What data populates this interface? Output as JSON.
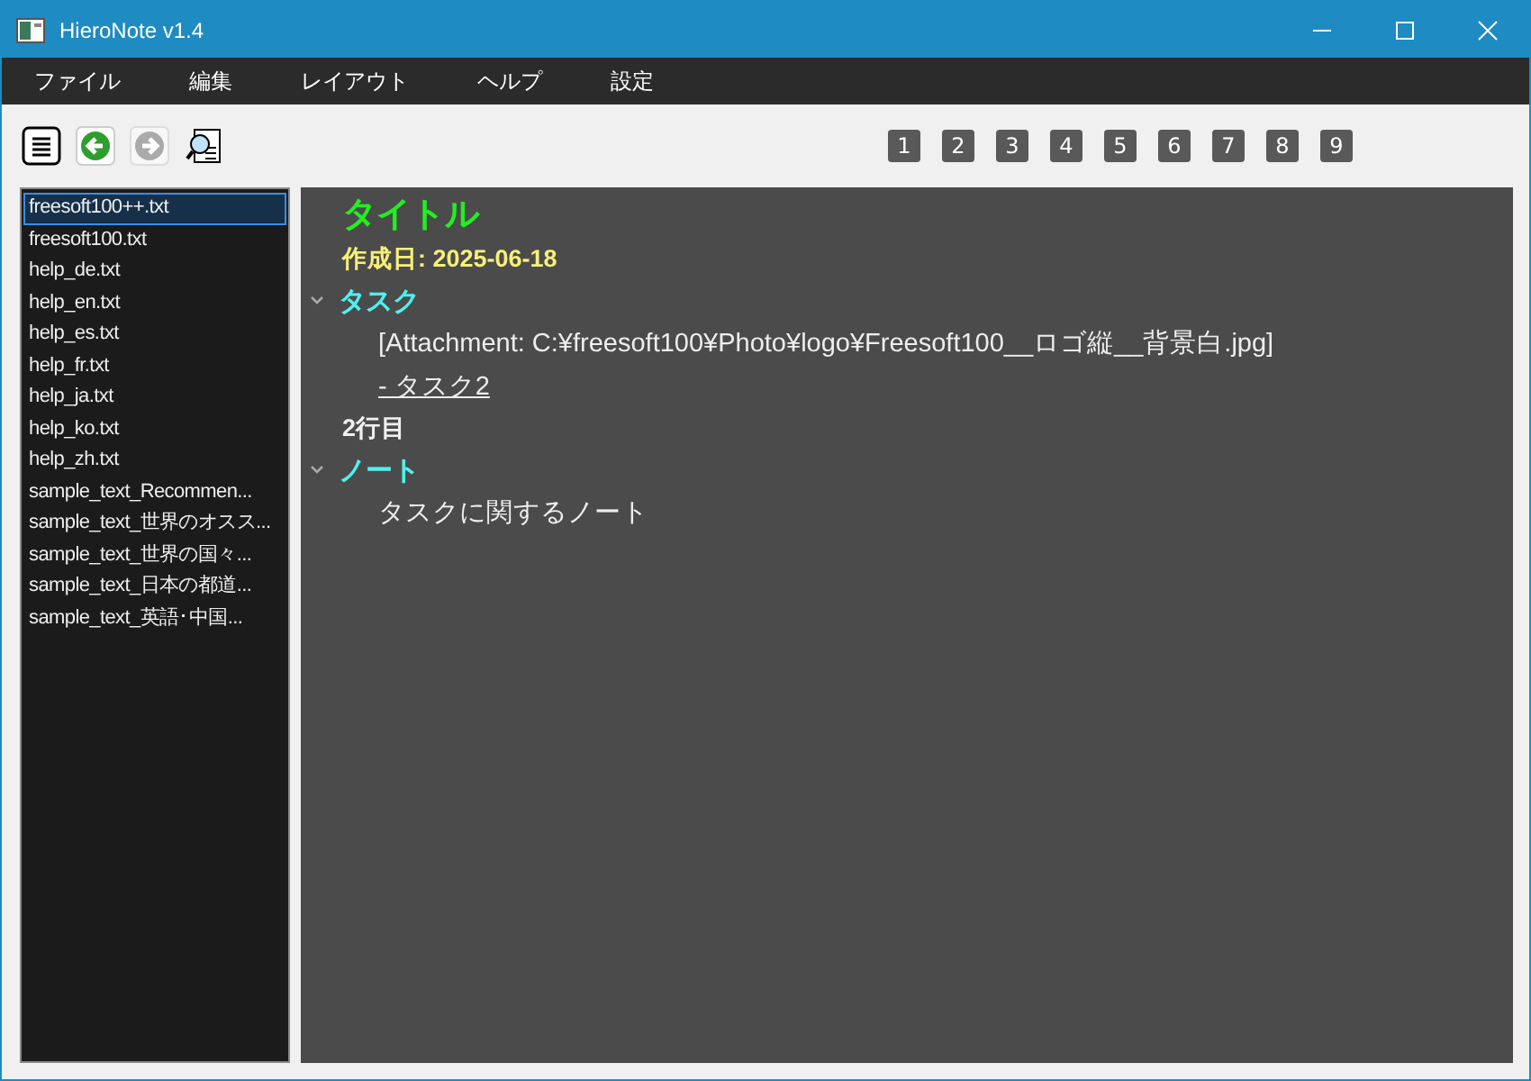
{
  "window": {
    "title": "HieroNote v1.4"
  },
  "menu": [
    "ファイル",
    "編集",
    "レイアウト",
    "ヘルプ",
    "設定"
  ],
  "toolbar": {
    "pages": [
      "1",
      "2",
      "3",
      "4",
      "5",
      "6",
      "7",
      "8",
      "9"
    ]
  },
  "files": [
    {
      "name": "freesoft100++.txt",
      "selected": true
    },
    {
      "name": "freesoft100.txt",
      "selected": false
    },
    {
      "name": "help_de.txt",
      "selected": false
    },
    {
      "name": "help_en.txt",
      "selected": false
    },
    {
      "name": "help_es.txt",
      "selected": false
    },
    {
      "name": "help_fr.txt",
      "selected": false
    },
    {
      "name": "help_ja.txt",
      "selected": false
    },
    {
      "name": "help_ko.txt",
      "selected": false
    },
    {
      "name": "help_zh.txt",
      "selected": false
    },
    {
      "name": "sample_text_Recommen...",
      "selected": false
    },
    {
      "name": "sample_text_世界のオスス...",
      "selected": false
    },
    {
      "name": "sample_text_世界の国々...",
      "selected": false
    },
    {
      "name": "sample_text_日本の都道...",
      "selected": false
    },
    {
      "name": "sample_text_英語･中国...",
      "selected": false
    }
  ],
  "document": [
    {
      "kind": "title",
      "text": "タイトル"
    },
    {
      "kind": "date",
      "text": "作成日: 2025-06-18"
    },
    {
      "kind": "section",
      "text": "タスク",
      "expanded": true,
      "children": [
        {
          "kind": "text",
          "text": "[Attachment: C:¥freesoft100¥Photo¥logo¥Freesoft100__ロゴ縦__背景白.jpg]"
        },
        {
          "kind": "link",
          "text": "- タスク2"
        }
      ]
    },
    {
      "kind": "bold",
      "text": "2行目"
    },
    {
      "kind": "section",
      "text": "ノート",
      "expanded": true,
      "children": [
        {
          "kind": "text",
          "text": "タスクに関するノート"
        }
      ]
    }
  ]
}
